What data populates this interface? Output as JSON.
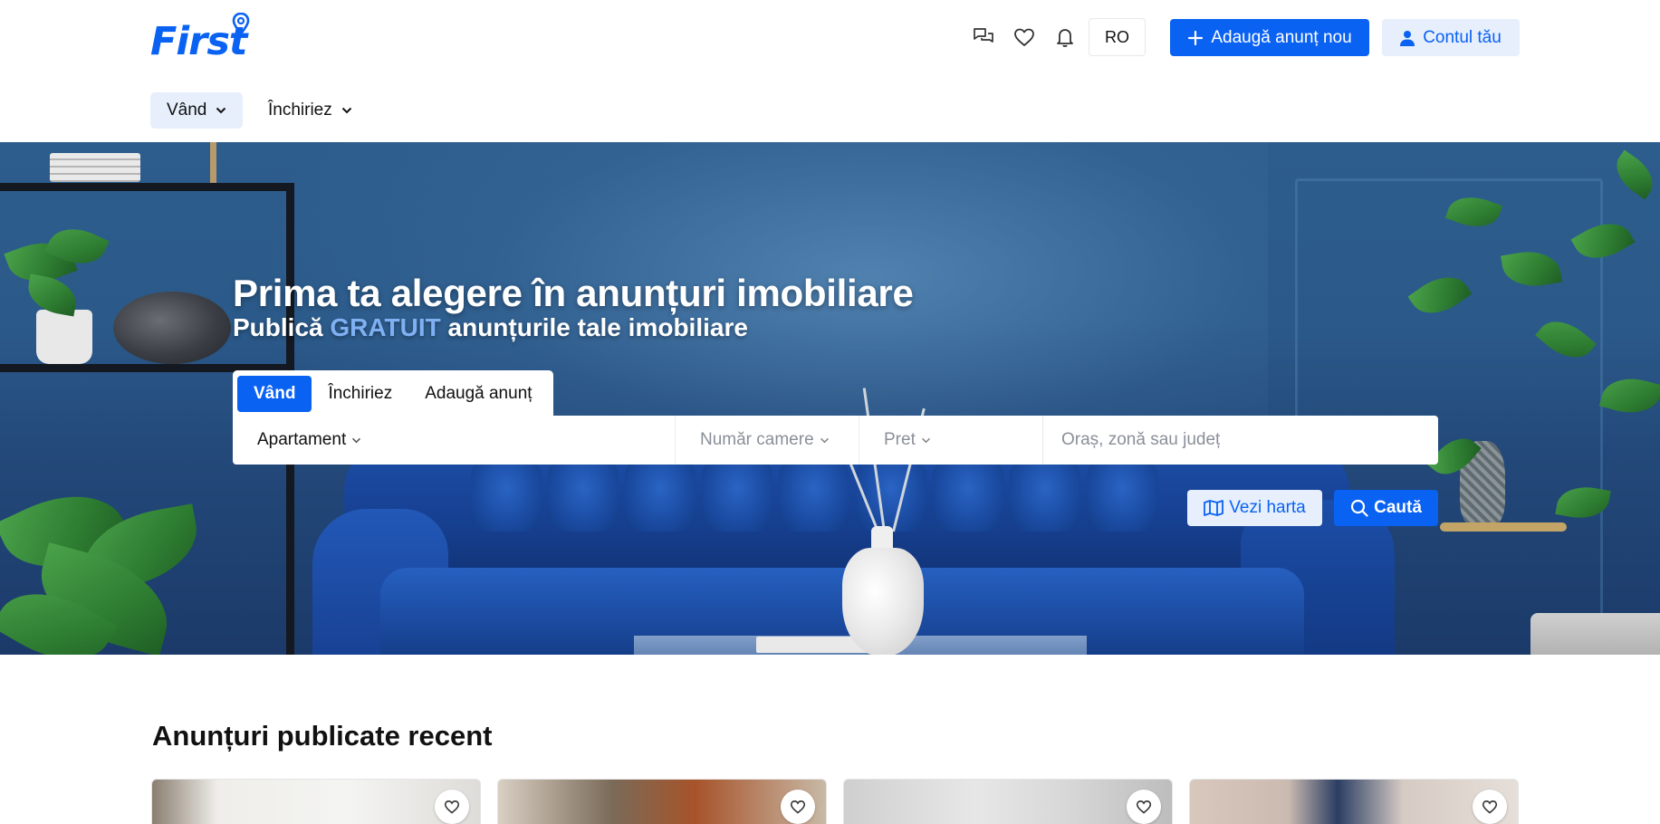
{
  "brand": {
    "logo_text": "First",
    "accent": "#0a62f2",
    "light_accent": "#e7effc"
  },
  "header": {
    "icons": [
      "chat-icon",
      "heart-icon",
      "bell-icon"
    ],
    "language": "RO",
    "add_button": "Adaugă anunț nou",
    "account_button": "Contul tău"
  },
  "nav": {
    "items": [
      {
        "label": "Vând",
        "active": true
      },
      {
        "label": "Închiriez",
        "active": false
      }
    ]
  },
  "hero": {
    "title": "Prima ta alegere în anunțuri imobiliare",
    "subtitle_before": "Publică",
    "subtitle_highlight": "GRATUIT",
    "subtitle_after": "anunțurile tale imobiliare",
    "tabs": [
      {
        "label": "Vând",
        "active": true
      },
      {
        "label": "Închiriez",
        "active": false
      },
      {
        "label": "Adaugă anunț",
        "active": false
      }
    ],
    "search": {
      "property_type": "Apartament",
      "rooms_placeholder": "Număr camere",
      "price_placeholder": "Pret",
      "location_placeholder": "Oraș, zonă sau județ"
    },
    "map_button": "Vezi harta",
    "search_button": "Caută"
  },
  "listings": {
    "title": "Anunțuri publicate recent",
    "cards": [
      {
        "photo": "kitchen-white"
      },
      {
        "photo": "room-wood"
      },
      {
        "photo": "wardrobe-white"
      },
      {
        "photo": "living-tv"
      }
    ]
  }
}
